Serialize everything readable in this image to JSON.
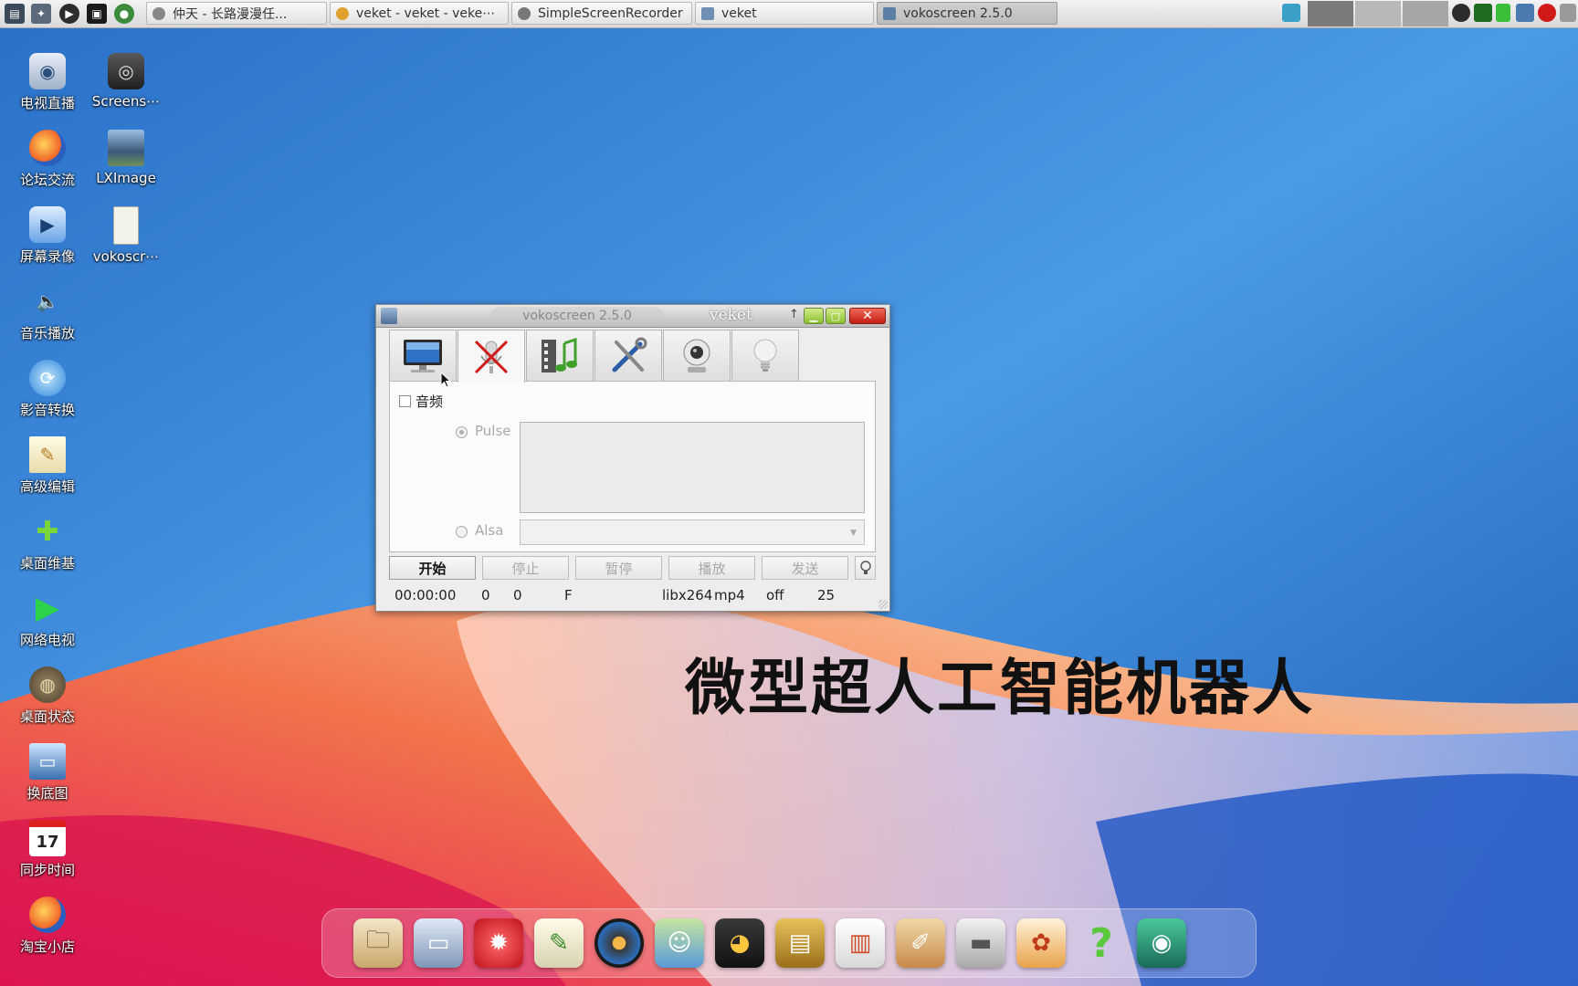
{
  "taskbar": {
    "tasks": [
      {
        "label": "仲天 - 长路漫漫任..."
      },
      {
        "label": "veket - veket - veke⋯"
      },
      {
        "label": "SimpleScreenRecorder"
      },
      {
        "label": "veket"
      },
      {
        "label": "vokoscreen 2.5.0"
      }
    ]
  },
  "desktop": {
    "icons": [
      {
        "label": "电视直播",
        "icon": "tv-icon"
      },
      {
        "label": "Screens⋯",
        "icon": "camera-icon"
      },
      {
        "label": "论坛交流",
        "icon": "firefox-icon"
      },
      {
        "label": "LXImage",
        "icon": "image-viewer-icon"
      },
      {
        "label": "屏幕录像",
        "icon": "screen-record-icon"
      },
      {
        "label": "vokoscr⋯",
        "icon": "file-icon"
      },
      {
        "label": "音乐播放",
        "icon": "speaker-icon"
      },
      {
        "label": "影音转换",
        "icon": "converter-icon"
      },
      {
        "label": "高级编辑",
        "icon": "editor-icon"
      },
      {
        "label": "桌面维基",
        "icon": "wiki-icon"
      },
      {
        "label": "网络电视",
        "icon": "play-icon"
      },
      {
        "label": "桌面状态",
        "icon": "status-icon"
      },
      {
        "label": "换底图",
        "icon": "wallpaper-icon"
      },
      {
        "label": "同步时间",
        "icon": "calendar-icon"
      },
      {
        "label": "淘宝小店",
        "icon": "firefox-icon"
      }
    ],
    "banner": "微型超人工智能机器人"
  },
  "window": {
    "title": "vokoscreen 2.5.0",
    "subtitle": "veket",
    "tabs": [
      "screen-icon",
      "microphone-muted-icon",
      "video-music-icon",
      "tools-icon",
      "webcam-icon",
      "lightbulb-icon"
    ],
    "audio": {
      "checkbox_label": "音频",
      "pulse_label": "Pulse",
      "alsa_label": "Alsa"
    },
    "buttons": {
      "start": "开始",
      "stop": "停止",
      "pause": "暂停",
      "play": "播放",
      "send": "发送"
    },
    "status": {
      "time": "00:00:00",
      "frames": "0",
      "size": "0",
      "fps_flag": "F",
      "codec": "libx264",
      "format": "mp4",
      "audio": "off",
      "fps": "25"
    }
  },
  "colors": {
    "accent": "#2f7fd6",
    "close": "#d9342a"
  }
}
